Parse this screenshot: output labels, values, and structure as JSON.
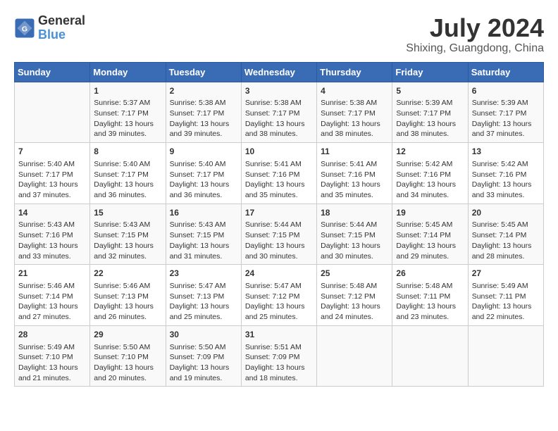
{
  "header": {
    "logo_line1": "General",
    "logo_line2": "Blue",
    "month": "July 2024",
    "location": "Shixing, Guangdong, China"
  },
  "days_of_week": [
    "Sunday",
    "Monday",
    "Tuesday",
    "Wednesday",
    "Thursday",
    "Friday",
    "Saturday"
  ],
  "weeks": [
    [
      {
        "day": "",
        "empty": true
      },
      {
        "day": "1",
        "sunrise": "5:37 AM",
        "sunset": "7:17 PM",
        "daylight": "13 hours and 39 minutes."
      },
      {
        "day": "2",
        "sunrise": "5:38 AM",
        "sunset": "7:17 PM",
        "daylight": "13 hours and 39 minutes."
      },
      {
        "day": "3",
        "sunrise": "5:38 AM",
        "sunset": "7:17 PM",
        "daylight": "13 hours and 38 minutes."
      },
      {
        "day": "4",
        "sunrise": "5:38 AM",
        "sunset": "7:17 PM",
        "daylight": "13 hours and 38 minutes."
      },
      {
        "day": "5",
        "sunrise": "5:39 AM",
        "sunset": "7:17 PM",
        "daylight": "13 hours and 38 minutes."
      },
      {
        "day": "6",
        "sunrise": "5:39 AM",
        "sunset": "7:17 PM",
        "daylight": "13 hours and 37 minutes."
      }
    ],
    [
      {
        "day": "7",
        "sunrise": "5:40 AM",
        "sunset": "7:17 PM",
        "daylight": "13 hours and 37 minutes."
      },
      {
        "day": "8",
        "sunrise": "5:40 AM",
        "sunset": "7:17 PM",
        "daylight": "13 hours and 36 minutes."
      },
      {
        "day": "9",
        "sunrise": "5:40 AM",
        "sunset": "7:17 PM",
        "daylight": "13 hours and 36 minutes."
      },
      {
        "day": "10",
        "sunrise": "5:41 AM",
        "sunset": "7:16 PM",
        "daylight": "13 hours and 35 minutes."
      },
      {
        "day": "11",
        "sunrise": "5:41 AM",
        "sunset": "7:16 PM",
        "daylight": "13 hours and 35 minutes."
      },
      {
        "day": "12",
        "sunrise": "5:42 AM",
        "sunset": "7:16 PM",
        "daylight": "13 hours and 34 minutes."
      },
      {
        "day": "13",
        "sunrise": "5:42 AM",
        "sunset": "7:16 PM",
        "daylight": "13 hours and 33 minutes."
      }
    ],
    [
      {
        "day": "14",
        "sunrise": "5:43 AM",
        "sunset": "7:16 PM",
        "daylight": "13 hours and 33 minutes."
      },
      {
        "day": "15",
        "sunrise": "5:43 AM",
        "sunset": "7:15 PM",
        "daylight": "13 hours and 32 minutes."
      },
      {
        "day": "16",
        "sunrise": "5:43 AM",
        "sunset": "7:15 PM",
        "daylight": "13 hours and 31 minutes."
      },
      {
        "day": "17",
        "sunrise": "5:44 AM",
        "sunset": "7:15 PM",
        "daylight": "13 hours and 30 minutes."
      },
      {
        "day": "18",
        "sunrise": "5:44 AM",
        "sunset": "7:15 PM",
        "daylight": "13 hours and 30 minutes."
      },
      {
        "day": "19",
        "sunrise": "5:45 AM",
        "sunset": "7:14 PM",
        "daylight": "13 hours and 29 minutes."
      },
      {
        "day": "20",
        "sunrise": "5:45 AM",
        "sunset": "7:14 PM",
        "daylight": "13 hours and 28 minutes."
      }
    ],
    [
      {
        "day": "21",
        "sunrise": "5:46 AM",
        "sunset": "7:14 PM",
        "daylight": "13 hours and 27 minutes."
      },
      {
        "day": "22",
        "sunrise": "5:46 AM",
        "sunset": "7:13 PM",
        "daylight": "13 hours and 26 minutes."
      },
      {
        "day": "23",
        "sunrise": "5:47 AM",
        "sunset": "7:13 PM",
        "daylight": "13 hours and 25 minutes."
      },
      {
        "day": "24",
        "sunrise": "5:47 AM",
        "sunset": "7:12 PM",
        "daylight": "13 hours and 25 minutes."
      },
      {
        "day": "25",
        "sunrise": "5:48 AM",
        "sunset": "7:12 PM",
        "daylight": "13 hours and 24 minutes."
      },
      {
        "day": "26",
        "sunrise": "5:48 AM",
        "sunset": "7:11 PM",
        "daylight": "13 hours and 23 minutes."
      },
      {
        "day": "27",
        "sunrise": "5:49 AM",
        "sunset": "7:11 PM",
        "daylight": "13 hours and 22 minutes."
      }
    ],
    [
      {
        "day": "28",
        "sunrise": "5:49 AM",
        "sunset": "7:10 PM",
        "daylight": "13 hours and 21 minutes."
      },
      {
        "day": "29",
        "sunrise": "5:50 AM",
        "sunset": "7:10 PM",
        "daylight": "13 hours and 20 minutes."
      },
      {
        "day": "30",
        "sunrise": "5:50 AM",
        "sunset": "7:09 PM",
        "daylight": "13 hours and 19 minutes."
      },
      {
        "day": "31",
        "sunrise": "5:51 AM",
        "sunset": "7:09 PM",
        "daylight": "13 hours and 18 minutes."
      },
      {
        "day": "",
        "empty": true
      },
      {
        "day": "",
        "empty": true
      },
      {
        "day": "",
        "empty": true
      }
    ]
  ]
}
